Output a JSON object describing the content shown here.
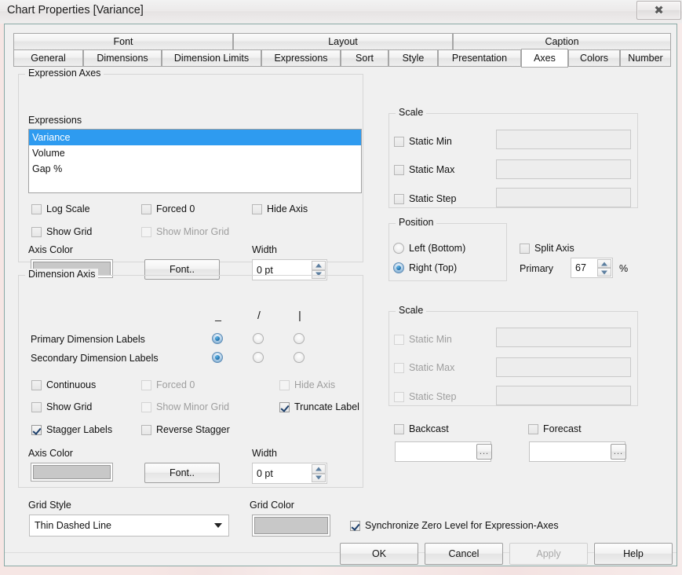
{
  "window": {
    "title": "Chart Properties [Variance]",
    "close_glyph": "✖",
    "close_label": "Close"
  },
  "tabs": {
    "top_row": [
      {
        "label": "Font"
      },
      {
        "label": "Layout"
      },
      {
        "label": "Caption"
      }
    ],
    "bottom_row": [
      {
        "label": "General",
        "selected": false
      },
      {
        "label": "Dimensions",
        "selected": false
      },
      {
        "label": "Dimension Limits",
        "selected": false
      },
      {
        "label": "Expressions",
        "selected": false
      },
      {
        "label": "Sort",
        "selected": false
      },
      {
        "label": "Style",
        "selected": false
      },
      {
        "label": "Presentation",
        "selected": false
      },
      {
        "label": "Axes",
        "selected": true
      },
      {
        "label": "Colors",
        "selected": false
      },
      {
        "label": "Number",
        "selected": false
      }
    ]
  },
  "expression_axes": {
    "legend": "Expression Axes",
    "expressions_label": "Expressions",
    "expressions": [
      {
        "name": "Variance",
        "selected": true
      },
      {
        "name": "Volume",
        "selected": false
      },
      {
        "name": "Gap %",
        "selected": false
      }
    ],
    "checks": [
      {
        "label": "Log Scale",
        "checked": false,
        "disabled": false
      },
      {
        "label": "Forced 0",
        "checked": false,
        "disabled": false
      },
      {
        "label": "Hide Axis",
        "checked": false,
        "disabled": false
      },
      {
        "label": "Show Grid",
        "checked": false,
        "disabled": false
      },
      {
        "label": "Show Minor Grid",
        "checked": false,
        "disabled": true
      }
    ],
    "axis_color_label": "Axis Color",
    "axis_color": "#c8c8c8",
    "font_button": "Font..",
    "width_label": "Width",
    "width_value": "0 pt",
    "scale": {
      "legend": "Scale",
      "rows": [
        {
          "label": "Static Min",
          "checked": false,
          "value": "",
          "disabled": false
        },
        {
          "label": "Static Max",
          "checked": false,
          "value": "",
          "disabled": false
        },
        {
          "label": "Static Step",
          "checked": false,
          "value": "",
          "disabled": false
        }
      ]
    },
    "position": {
      "legend": "Position",
      "options": [
        {
          "label": "Left (Bottom)",
          "selected": false
        },
        {
          "label": "Right (Top)",
          "selected": true
        }
      ]
    },
    "split_axis": {
      "label": "Split Axis",
      "checked": false
    },
    "primary_label": "Primary",
    "primary_value": "67",
    "percent_sign": "%"
  },
  "dimension_axis": {
    "legend": "Dimension Axis",
    "orientation_headers": [
      "_",
      "/",
      "|"
    ],
    "label_rows": [
      {
        "label": "Primary Dimension Labels",
        "selected_index": 0
      },
      {
        "label": "Secondary Dimension Labels",
        "selected_index": 0
      }
    ],
    "checks": [
      {
        "label": "Continuous",
        "checked": false,
        "disabled": false
      },
      {
        "label": "Forced 0",
        "checked": false,
        "disabled": true
      },
      {
        "label": "Hide Axis",
        "checked": false,
        "disabled": true
      },
      {
        "label": "Show Grid",
        "checked": false,
        "disabled": false
      },
      {
        "label": "Show Minor Grid",
        "checked": false,
        "disabled": true
      },
      {
        "label": "Truncate Label",
        "checked": true,
        "disabled": false
      },
      {
        "label": "Stagger Labels",
        "checked": true,
        "disabled": false
      },
      {
        "label": "Reverse Stagger",
        "checked": false,
        "disabled": false
      }
    ],
    "axis_color_label": "Axis Color",
    "axis_color": "#c8c8c8",
    "font_button": "Font..",
    "width_label": "Width",
    "width_value": "0 pt",
    "scale": {
      "legend": "Scale",
      "rows": [
        {
          "label": "Static Min",
          "checked": false,
          "value": "",
          "disabled": true
        },
        {
          "label": "Static Max",
          "checked": false,
          "value": "",
          "disabled": true
        },
        {
          "label": "Static Step",
          "checked": false,
          "value": "",
          "disabled": true
        }
      ]
    },
    "backcast": {
      "label": "Backcast",
      "checked": false,
      "value": "",
      "browse": "..."
    },
    "forecast": {
      "label": "Forecast",
      "checked": false,
      "value": "",
      "browse": "..."
    }
  },
  "bottom": {
    "grid_style_label": "Grid Style",
    "grid_style_value": "Thin Dashed Line",
    "grid_color_label": "Grid Color",
    "grid_color": "#c8c8c8",
    "sync_zero": {
      "label": "Synchronize Zero Level for Expression-Axes",
      "checked": true
    }
  },
  "footer": {
    "ok": "OK",
    "cancel": "Cancel",
    "apply": "Apply",
    "help": "Help"
  }
}
